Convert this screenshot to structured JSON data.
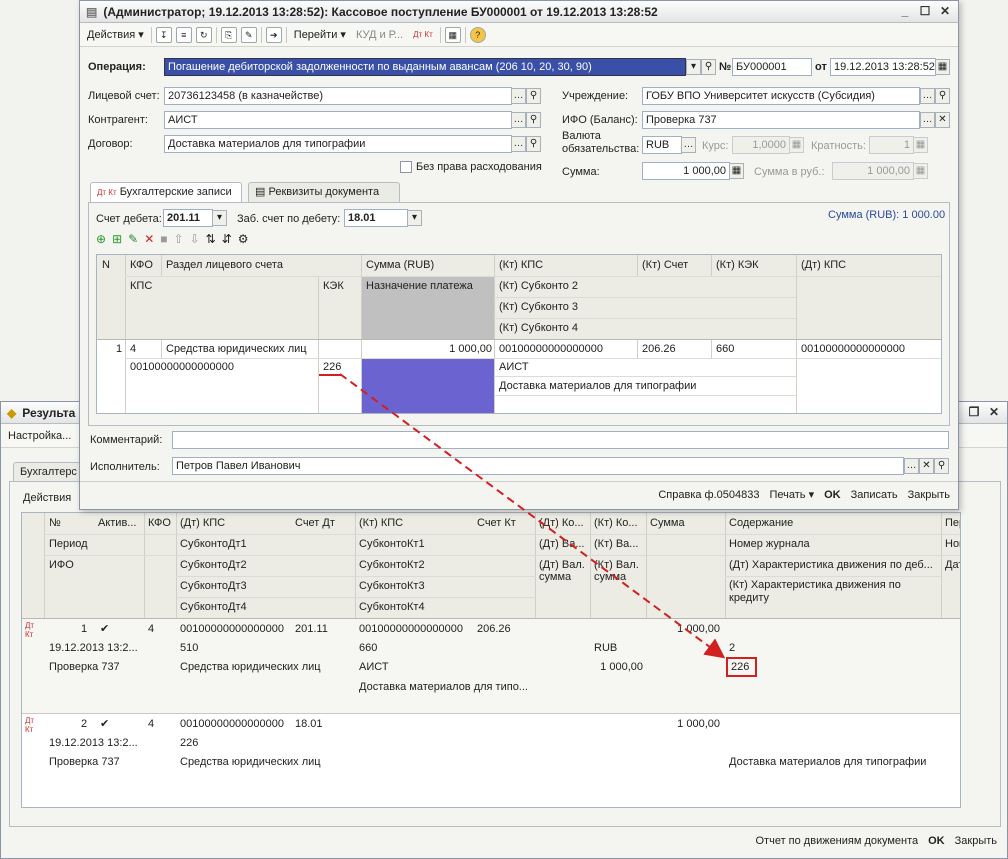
{
  "back_window": {
    "title": "Результа",
    "menu_label": "Настройка...",
    "tab_label": "Бухгалтерс",
    "actions_label": "Действия",
    "headers": {
      "row1": [
        "№",
        "Актив...",
        "КФО",
        "(Дт) КПС",
        "Счет Дт",
        "(Кт) КПС",
        "Счет Кт",
        "(Дт) Ко...",
        "(Кт) Ко...",
        "Сумма",
        "Содержание",
        "Перв..."
      ],
      "row2": [
        "Период",
        "СубконтоДт1",
        "СубконтоКт1",
        "(Дт) Ва...",
        "(Кт) Ва...",
        "Номер журнала",
        "Номер"
      ],
      "row3": [
        "ИФО",
        "СубконтоДт2",
        "СубконтоКт2",
        "(Дт) Вал. сумма",
        "(Кт) Вал. сумма",
        "(Дт) Характеристика движения по деб...",
        "Дата"
      ],
      "row4": [
        "СубконтоДт3",
        "СубконтоКт3",
        "(Кт) Характеристика движения по кредиту"
      ],
      "row5": [
        "СубконтоДт4",
        "СубконтоКт4"
      ]
    },
    "rows": [
      {
        "num": "1",
        "check": "✔",
        "kfo": "4",
        "dt_kps": "00100000000000000",
        "schet_dt": "201.11",
        "kt_kps": "00100000000000000",
        "schet_kt": "206.26",
        "summa": "1 000,00",
        "period": "19.12.2013 13:2...",
        "subkonto_dt1": "510",
        "subkonto_kt1": "660",
        "kt_val": "RUB",
        "journal": "2",
        "ifo": "Проверка 737",
        "subkonto_dt2": "Средства юридических лиц",
        "subkonto_kt2": "АИСТ",
        "kt_val_sum": "1 000,00",
        "characteristic": "226",
        "subkonto_kt3": "Доставка материалов для типо..."
      },
      {
        "num": "2",
        "check": "✔",
        "kfo": "4",
        "dt_kps": "00100000000000000",
        "schet_dt": "18.01",
        "summa": "1 000,00",
        "period": "19.12.2013 13:2...",
        "subkonto_dt1": "226",
        "ifo": "Проверка 737",
        "subkonto_dt2": "Средства юридических лиц",
        "content": "Доставка материалов для типографии"
      }
    ],
    "footer": {
      "report": "Отчет по движениям документа",
      "ok": "OK",
      "close": "Закрыть"
    }
  },
  "front_window": {
    "title": "(Администратор; 19.12.2013 13:28:52): Кассовое поступление БУ000001 от 19.12.2013 13:28:52",
    "toolbar": {
      "actions": "Действия",
      "goto": "Перейти",
      "kud": "КУД и Р...",
      "dtkt": "Дт Кт"
    },
    "operation_label": "Операция:",
    "operation_value": "Погашение дебиторской задолженности по выданным авансам (206 10, 20, 30, 90)",
    "number_label": "№",
    "number_value": "БУ000001",
    "date_label": "от",
    "date_value": "19.12.2013 13:28:52",
    "account_label": "Лицевой счет:",
    "account_value": "20736123458 (в казначействе)",
    "institution_label": "Учреждение:",
    "institution_value": "ГОБУ ВПО Университет искусств (Субсидия)",
    "counterparty_label": "Контрагент:",
    "counterparty_value": "АИСТ",
    "ifo_label": "ИФО (Баланс):",
    "ifo_value": "Проверка 737",
    "contract_label": "Договор:",
    "contract_value": "Доставка материалов для типографии",
    "currency_label_1": "Валюта",
    "currency_label_2": "обязательства:",
    "currency_value": "RUB",
    "rate_label": "Курс:",
    "rate_value": "1,0000",
    "multiplicity_label": "Кратность:",
    "multiplicity_value": "1",
    "no_spending_label": "Без права расходования",
    "sum_label": "Сумма:",
    "sum_value": "1 000,00",
    "sum_rub_label": "Сумма в руб.:",
    "sum_rub_value": "1 000,00",
    "tabs": [
      "Бухгалтерские записи",
      "Реквизиты документа"
    ],
    "debit_label": "Счет дебета:",
    "debit_value": "201.11",
    "offbal_label": "Заб. счет по дебету:",
    "offbal_value": "18.01",
    "sum_total": "Сумма (RUB): 1 000.00",
    "grid_headers": {
      "r1": [
        "N",
        "КФО",
        "Раздел лицевого счета",
        "Сумма (RUB)",
        "(Кт) КПС",
        "(Кт) Счет",
        "(Кт) КЭК",
        "(Дт) КПС"
      ],
      "r2": [
        "КПС",
        "КЭК",
        "Назначение платежа",
        "(Кт) Субконто 2"
      ],
      "r3": [
        "(Кт) Субконто 3"
      ],
      "r4": [
        "(Кт) Субконто 4"
      ]
    },
    "grid_row": {
      "n": "1",
      "kfo": "4",
      "section": "Средства юридических лиц",
      "sum": "1 000,00",
      "kt_kps": "00100000000000000",
      "kt_schet": "206.26",
      "kt_kek": "660",
      "dt_kps": "00100000000000000",
      "kps": "00100000000000000",
      "kek": "226",
      "kt_sub2": "АИСТ",
      "kt_sub3": "Доставка материалов для типографии"
    },
    "comment_label": "Комментарий:",
    "executor_label": "Исполнитель:",
    "executor_value": "Петров Павел Иванович",
    "footer": {
      "help": "Справка ф.0504833",
      "print": "Печать",
      "ok": "OK",
      "save": "Записать",
      "close": "Закрыть"
    }
  },
  "colors": {
    "highlight": "#3a4fa8",
    "purple_cell": "#6b63cf",
    "arrow": "#d22020"
  }
}
